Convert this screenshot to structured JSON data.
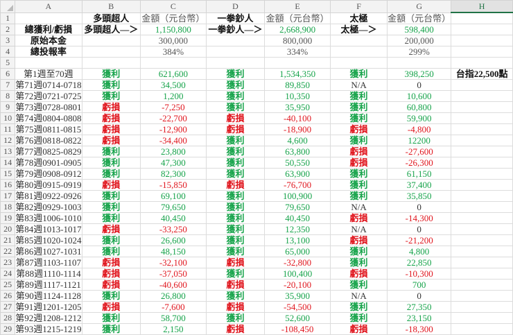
{
  "columns": [
    "",
    "A",
    "B",
    "C",
    "D",
    "E",
    "F",
    "G",
    "H"
  ],
  "selected_column": "H",
  "colors": {
    "profit": "#16a34a",
    "loss": "#e0161e"
  },
  "rows": [
    [
      "",
      "多頭超人",
      "金額（元台幣）",
      "一拳鈔人",
      "金額（元台幣）",
      "太極",
      "金額（元台幣）",
      ""
    ],
    [
      "總獲利/虧損",
      "多頭超人—＞",
      "1,150,800",
      "一拳鈔人—＞",
      "2,668,900",
      "太極—＞",
      "598,400",
      ""
    ],
    [
      "原始本金",
      "",
      "300,000",
      "",
      "800,000",
      "",
      "200,000",
      ""
    ],
    [
      "總投報率",
      "",
      "384%",
      "",
      "334%",
      "",
      "299%",
      ""
    ],
    [
      "",
      "",
      "",
      "",
      "",
      "",
      "",
      ""
    ],
    [
      "第1週至70週",
      "獲利",
      "621,600",
      "獲利",
      "1,534,350",
      "獲利",
      "398,250",
      "台指22,500點"
    ],
    [
      "第71週0714-0718",
      "獲利",
      "34,500",
      "獲利",
      "89,850",
      "N/A",
      "0",
      ""
    ],
    [
      "第72週0721-0725",
      "獲利",
      "1,200",
      "獲利",
      "10,350",
      "獲利",
      "10,600",
      ""
    ],
    [
      "第73週0728-0801",
      "虧損",
      "-7,250",
      "獲利",
      "35,950",
      "獲利",
      "60,800",
      ""
    ],
    [
      "第74週0804-0808",
      "虧損",
      "-22,700",
      "虧損",
      "-40,100",
      "獲利",
      "59,900",
      ""
    ],
    [
      "第75週0811-0815",
      "虧損",
      "-12,900",
      "虧損",
      "-18,900",
      "虧損",
      "-4,800",
      ""
    ],
    [
      "第76週0818-0822",
      "虧損",
      "-34,400",
      "獲利",
      "4,600",
      "獲利",
      "12200",
      ""
    ],
    [
      "第77週0825-0829",
      "獲利",
      "23,800",
      "獲利",
      "63,800",
      "虧損",
      "-27,600",
      ""
    ],
    [
      "第78週0901-0905",
      "獲利",
      "47,300",
      "獲利",
      "50,550",
      "虧損",
      "-26,300",
      ""
    ],
    [
      "第79週0908-0912",
      "獲利",
      "82,300",
      "獲利",
      "63,900",
      "獲利",
      "61,150",
      ""
    ],
    [
      "第80週0915-0919",
      "虧損",
      "-15,850",
      "虧損",
      "-76,700",
      "獲利",
      "37,400",
      ""
    ],
    [
      "第81週0922-0926",
      "獲利",
      "69,100",
      "獲利",
      "100,900",
      "獲利",
      "35,850",
      ""
    ],
    [
      "第82週0929-1003",
      "獲利",
      "79,650",
      "獲利",
      "79,650",
      "N/A",
      "0",
      ""
    ],
    [
      "第83週1006-1010",
      "獲利",
      "40,450",
      "獲利",
      "40,450",
      "虧損",
      "-14,300",
      ""
    ],
    [
      "第84週1013-1017",
      "虧損",
      "-33,250",
      "獲利",
      "12,350",
      "N/A",
      "0",
      ""
    ],
    [
      "第85週1020-1024",
      "獲利",
      "26,600",
      "獲利",
      "13,100",
      "虧損",
      "-21,200",
      ""
    ],
    [
      "第86週1027-1031",
      "獲利",
      "48,150",
      "獲利",
      "65,000",
      "獲利",
      "4,800",
      ""
    ],
    [
      "第87週1103-1107",
      "虧損",
      "-32,100",
      "虧損",
      "-32,800",
      "獲利",
      "22,850",
      ""
    ],
    [
      "第88週1110-1114",
      "虧損",
      "-37,050",
      "獲利",
      "100,400",
      "虧損",
      "-10,300",
      ""
    ],
    [
      "第89週1117-1121",
      "虧損",
      "-40,600",
      "虧損",
      "-20,100",
      "獲利",
      "700",
      ""
    ],
    [
      "第90週1124-1128",
      "獲利",
      "26,800",
      "獲利",
      "35,900",
      "N/A",
      "0",
      ""
    ],
    [
      "第91週1201-1205",
      "虧損",
      "-7,600",
      "虧損",
      "-54,500",
      "獲利",
      "27,350",
      ""
    ],
    [
      "第92週1208-1212",
      "獲利",
      "58,700",
      "獲利",
      "52,600",
      "獲利",
      "23,150",
      ""
    ],
    [
      "第93週1215-1219",
      "獲利",
      "2,150",
      "虧損",
      "-108,450",
      "虧損",
      "-18,300",
      ""
    ]
  ]
}
